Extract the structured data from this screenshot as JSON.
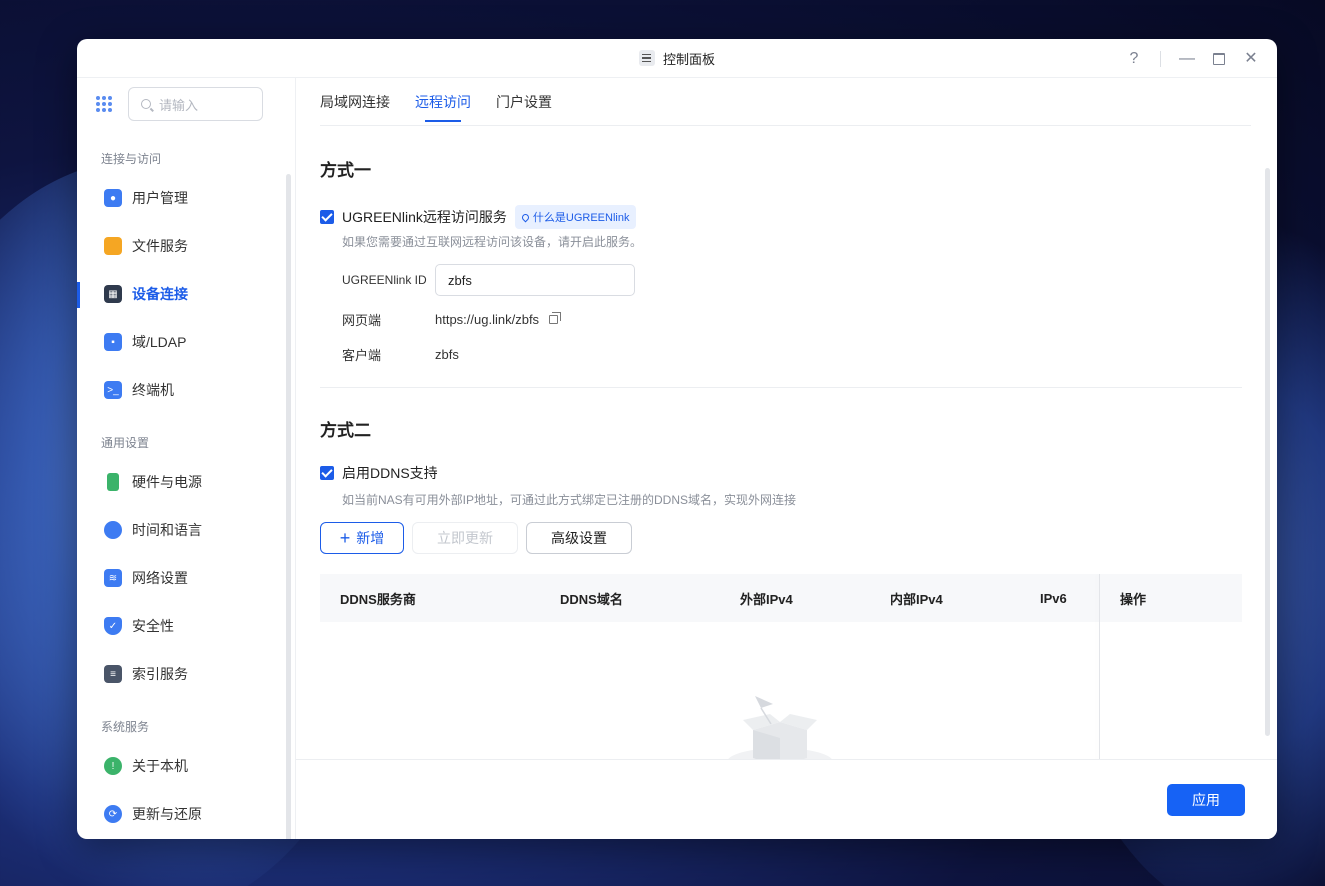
{
  "window": {
    "title": "控制面板"
  },
  "sidebar": {
    "search_placeholder": "请输入",
    "sections": [
      {
        "label": "连接与访问",
        "items": [
          {
            "label": "用户管理",
            "icon": "user-icon",
            "color": "#3d7bf2"
          },
          {
            "label": "文件服务",
            "icon": "folder-icon",
            "color": "#f5a623"
          },
          {
            "label": "设备连接",
            "icon": "device-icon",
            "color": "#2f3a4d",
            "active": true
          },
          {
            "label": "域/LDAP",
            "icon": "directory-icon",
            "color": "#3d7bf2"
          },
          {
            "label": "终端机",
            "icon": "terminal-icon",
            "color": "#3d7bf2"
          }
        ]
      },
      {
        "label": "通用设置",
        "items": [
          {
            "label": "硬件与电源",
            "icon": "battery-icon",
            "color": "#3bb36a"
          },
          {
            "label": "时间和语言",
            "icon": "globe-icon",
            "color": "#3d7bf2"
          },
          {
            "label": "网络设置",
            "icon": "wifi-icon",
            "color": "#3d7bf2"
          },
          {
            "label": "安全性",
            "icon": "shield-icon",
            "color": "#3d7bf2"
          },
          {
            "label": "索引服务",
            "icon": "index-icon",
            "color": "#4a5568"
          }
        ]
      },
      {
        "label": "系统服务",
        "items": [
          {
            "label": "关于本机",
            "icon": "info-icon",
            "color": "#3bb36a"
          },
          {
            "label": "更新与还原",
            "icon": "refresh-icon",
            "color": "#3d7bf2"
          }
        ]
      }
    ]
  },
  "tabs": [
    {
      "label": "局域网连接"
    },
    {
      "label": "远程访问",
      "active": true
    },
    {
      "label": "门户设置"
    }
  ],
  "method1": {
    "title": "方式一",
    "checkbox_label": "UGREENlink远程访问服务",
    "checked": true,
    "help_pill": "什么是UGREENlink",
    "hint": "如果您需要通过互联网远程访问该设备，请开启此服务。",
    "id_label": "UGREENlink ID",
    "id_value": "zbfs",
    "web_label": "网页端",
    "web_value": "https://ug.link/zbfs",
    "client_label": "客户端",
    "client_value": "zbfs"
  },
  "method2": {
    "title": "方式二",
    "checkbox_label": "启用DDNS支持",
    "checked": true,
    "hint": "如当前NAS有可用外部IP地址，可通过此方式绑定已注册的DDNS域名，实现外网连接",
    "add_button": "新增",
    "update_button": "立即更新",
    "advanced_button": "高级设置",
    "columns": [
      "DDNS服务商",
      "DDNS域名",
      "外部IPv4",
      "内部IPv4",
      "IPv6",
      "操作"
    ]
  },
  "footer": {
    "apply_button": "应用"
  }
}
